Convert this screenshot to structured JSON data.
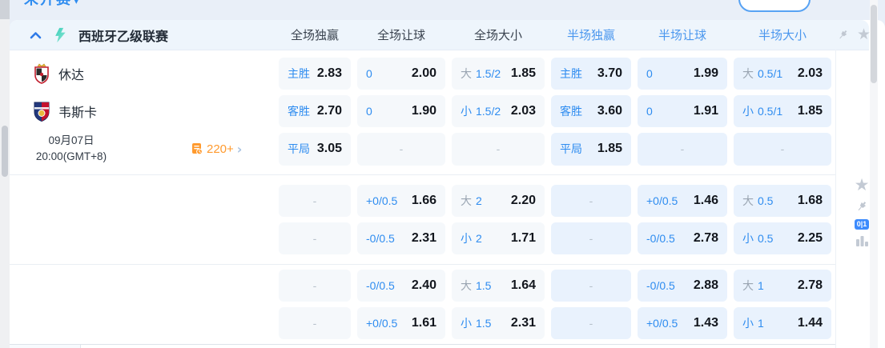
{
  "top_bar": {
    "filter_label": "未开赛",
    "caret": "▾"
  },
  "league_header": {
    "league_name": "西班牙乙级联赛",
    "column_headers": [
      {
        "label": "全场独赢",
        "scope": "full"
      },
      {
        "label": "全场让球",
        "scope": "full"
      },
      {
        "label": "全场大小",
        "scope": "full"
      },
      {
        "label": "半场独赢",
        "scope": "half"
      },
      {
        "label": "半场让球",
        "scope": "half"
      },
      {
        "label": "半场大小",
        "scope": "half"
      }
    ]
  },
  "icons": {
    "star": "★",
    "chevron_right": "›"
  },
  "match": {
    "home_team": "休达",
    "away_team": "韦斯卡",
    "date": "09月07日",
    "time": "20:00(GMT+8)",
    "markets_count": "220+"
  },
  "side_tools": {
    "odds_format_badge": "0|1"
  },
  "odds": {
    "dash": "-",
    "blocks": [
      {
        "rows": [
          {
            "name": "home",
            "cells": [
              {
                "label": "主胜",
                "value": "2.83"
              },
              {
                "label": "0",
                "value": "2.00"
              },
              {
                "label": "大",
                "muted": true,
                "label2": "1.5/2",
                "value": "1.85"
              },
              {
                "label": "主胜",
                "value": "3.70"
              },
              {
                "label": "0",
                "value": "1.99"
              },
              {
                "label": "大",
                "muted": true,
                "label2": "0.5/1",
                "value": "2.03"
              }
            ]
          },
          {
            "name": "away",
            "cells": [
              {
                "label": "客胜",
                "value": "2.70"
              },
              {
                "label": "0",
                "value": "1.90"
              },
              {
                "label": "小",
                "label2": "1.5/2",
                "value": "2.03"
              },
              {
                "label": "客胜",
                "value": "3.60"
              },
              {
                "label": "0",
                "value": "1.91"
              },
              {
                "label": "小",
                "label2": "0.5/1",
                "value": "1.85"
              }
            ]
          },
          {
            "name": "info",
            "cells": [
              {
                "label": "平局",
                "value": "3.05"
              },
              {
                "dash": true
              },
              {
                "dash": true
              },
              {
                "label": "平局",
                "value": "1.85"
              },
              {
                "dash": true
              },
              {
                "dash": true
              }
            ]
          }
        ]
      },
      {
        "rows": [
          {
            "name": "empty",
            "cells": [
              {
                "dash": true
              },
              {
                "label": "+0/0.5",
                "value": "1.66"
              },
              {
                "label": "大",
                "muted": true,
                "label2": "2",
                "value": "2.20"
              },
              {
                "dash": true
              },
              {
                "label": "+0/0.5",
                "value": "1.46"
              },
              {
                "label": "大",
                "muted": true,
                "label2": "0.5",
                "value": "1.68"
              }
            ]
          },
          {
            "name": "empty",
            "cells": [
              {
                "dash": true
              },
              {
                "label": "-0/0.5",
                "value": "2.31"
              },
              {
                "label": "小",
                "label2": "2",
                "value": "1.71"
              },
              {
                "dash": true
              },
              {
                "label": "-0/0.5",
                "value": "2.78"
              },
              {
                "label": "小",
                "label2": "0.5",
                "value": "2.25"
              }
            ]
          }
        ]
      },
      {
        "rows": [
          {
            "name": "empty",
            "cells": [
              {
                "dash": true
              },
              {
                "label": "-0/0.5",
                "value": "2.40"
              },
              {
                "label": "大",
                "muted": true,
                "label2": "1.5",
                "value": "1.64"
              },
              {
                "dash": true
              },
              {
                "label": "-0/0.5",
                "value": "2.88"
              },
              {
                "label": "大",
                "muted": true,
                "label2": "1",
                "value": "2.78"
              }
            ]
          },
          {
            "name": "empty",
            "cells": [
              {
                "dash": true
              },
              {
                "label": "+0/0.5",
                "value": "1.61"
              },
              {
                "label": "小",
                "label2": "1.5",
                "value": "2.31"
              },
              {
                "dash": true
              },
              {
                "label": "+0/0.5",
                "value": "1.43"
              },
              {
                "label": "小",
                "label2": "1",
                "value": "1.44"
              }
            ]
          }
        ]
      }
    ]
  },
  "colors": {
    "accent_blue": "#2e8cf0",
    "half_header_blue": "#4b97ee",
    "muted_label": "#9aa5b2",
    "odds_value": "#12161d",
    "full_cell_bg": "#f5f8fb",
    "half_cell_bg": "#e9f2fd",
    "markets_orange": "#ff9a2e",
    "header_band_bg": "#eef5fc"
  }
}
